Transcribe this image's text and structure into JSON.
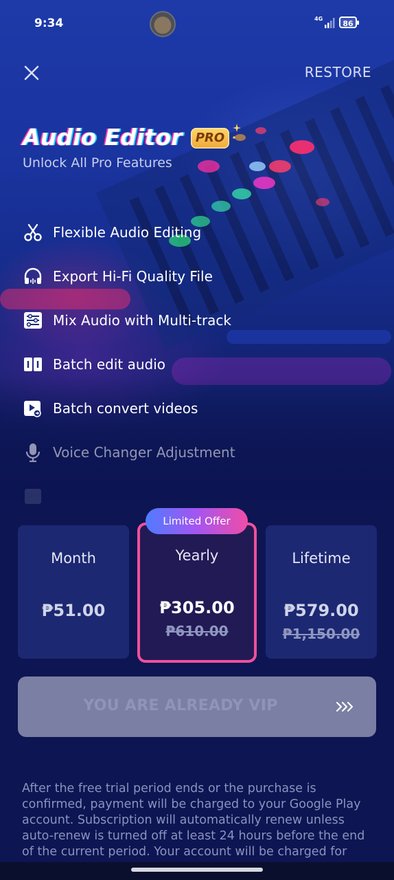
{
  "status_bar": {
    "time": "9:34",
    "network": "4G",
    "battery": "86"
  },
  "header": {
    "restore_label": "RESTORE"
  },
  "hero": {
    "title": "Audio Editor",
    "badge": "PRO",
    "subtitle": "Unlock All Pro Features"
  },
  "features": [
    {
      "label": "Flexible Audio Editing",
      "icon": "scissors-icon"
    },
    {
      "label": "Export Hi-Fi Quality File",
      "icon": "headphones-icon"
    },
    {
      "label": "Mix Audio with Multi-track",
      "icon": "sliders-icon"
    },
    {
      "label": "Batch edit audio",
      "icon": "batch-edit-icon"
    },
    {
      "label": "Batch convert videos",
      "icon": "video-convert-icon"
    },
    {
      "label": "Voice Changer Adjustment",
      "icon": "microphone-icon"
    }
  ],
  "plans": {
    "offer_tag": "Limited Offer",
    "items": [
      {
        "name": "Month",
        "price": "₱51.00",
        "old_price": ""
      },
      {
        "name": "Yearly",
        "price": "₱305.00",
        "old_price": "₱610.00"
      },
      {
        "name": "Lifetime",
        "price": "₱579.00",
        "old_price": "₱1,150.00"
      }
    ]
  },
  "cta": {
    "label": "YOU ARE ALREADY VIP"
  },
  "disclaimer": "After the free trial period ends or the purchase is confirmed, payment will be charged to your Google Play account. Subscription will automatically renew unless auto-renew is turned off at least 24 hours before the end of the current period. Your account will be charged for",
  "colors": {
    "background": "#0d1553",
    "plan_card": "#1d2872",
    "selected_border": "#f0509b",
    "badge_gold": "#f0a83a",
    "cta_disabled": "#7b7fa4"
  }
}
